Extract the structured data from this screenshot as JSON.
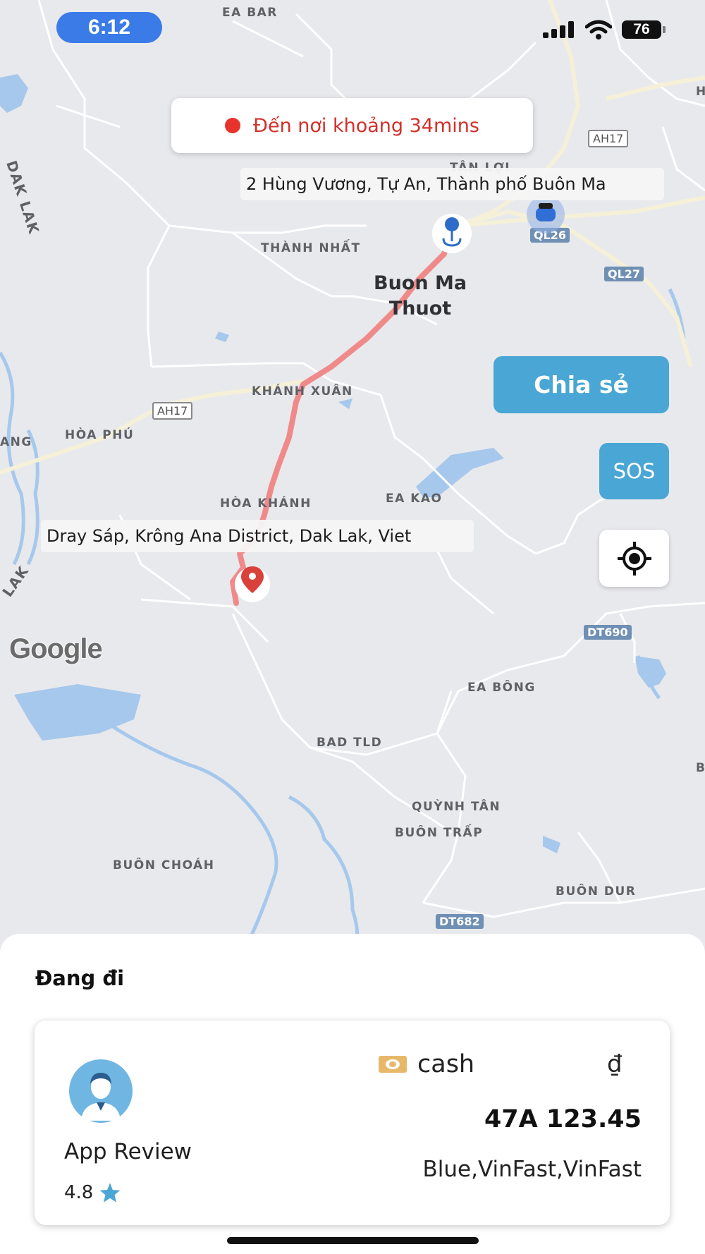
{
  "status_bar": {
    "time": "6:12",
    "battery": "76"
  },
  "map": {
    "eta_text": "Đến nơi khoảng 34mins",
    "origin_address": "2 Hùng Vương, Tự An, Thành phố Buôn Ma",
    "destination_address": "Dray Sáp, Krông Ana District, Dak Lak, Viet",
    "city_line1": "Buon Ma",
    "city_line2": "Thuot",
    "places": [
      "EA BAR",
      "TÂN LỢI",
      "THÀNH NHẤT",
      "KHÁNH XUÂN",
      "HÒA PHÚ",
      "HÒA KHÁNH",
      "EA KAO",
      "EA BÔNG",
      "BAD TLD",
      "QUỲNH TÂN",
      "BUÔN TRẤP",
      "BUÔN CHOÁH",
      "BUÔN DUR",
      "DAK LAK",
      "LAK",
      "ANG",
      "H",
      "B"
    ],
    "road_shields": [
      "AH17",
      "QL26",
      "QL27",
      "AH17",
      "DT690",
      "DT682"
    ],
    "logo": "Google",
    "route_color": "#f08a8a",
    "water_color": "#a6c8ec"
  },
  "actions": {
    "share_label": "Chia sẻ",
    "sos_label": "SOS",
    "locate_icon": "crosshair-icon"
  },
  "trip": {
    "status_title": "Đang đi",
    "driver_name": "App Review",
    "rating": "4.8",
    "payment_method": "cash",
    "currency_symbol": "₫",
    "plate_number": "47A 123.45",
    "vehicle_info": "Blue,VinFast,VinFast"
  },
  "colors": {
    "accent": "#4aa6d5",
    "eta_red": "#d2302a",
    "time_pill": "#3a7be8"
  }
}
